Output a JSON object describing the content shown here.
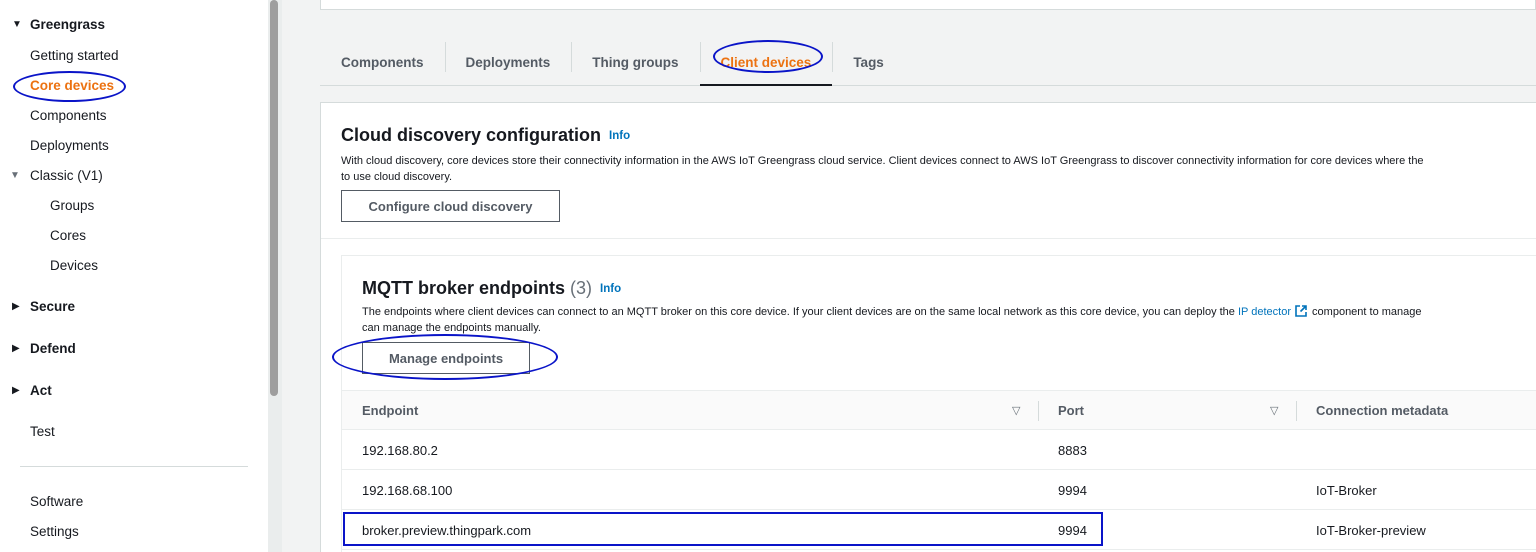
{
  "sidebar": {
    "section_title": "Greengrass",
    "items": [
      {
        "label": "Getting started"
      },
      {
        "label": "Core devices"
      },
      {
        "label": "Components"
      },
      {
        "label": "Deployments"
      },
      {
        "label": "Classic (V1)"
      },
      {
        "label": "Groups"
      },
      {
        "label": "Cores"
      },
      {
        "label": "Devices"
      }
    ],
    "sections": [
      {
        "label": "Secure"
      },
      {
        "label": "Defend"
      },
      {
        "label": "Act"
      }
    ],
    "test_label": "Test",
    "software_label": "Software",
    "settings_label": "Settings"
  },
  "tabs": [
    {
      "label": "Components"
    },
    {
      "label": "Deployments"
    },
    {
      "label": "Thing groups"
    },
    {
      "label": "Client devices"
    },
    {
      "label": "Tags"
    }
  ],
  "cloud_discovery": {
    "title": "Cloud discovery configuration",
    "info": "Info",
    "description_line1": "With cloud discovery, core devices store their connectivity information in the AWS IoT Greengrass cloud service. Client devices connect to AWS IoT Greengrass to discover connectivity information for core devices where the",
    "description_line2": "to use cloud discovery.",
    "button": "Configure cloud discovery"
  },
  "mqtt": {
    "title": "MQTT broker endpoints",
    "count": "(3)",
    "info": "Info",
    "description_pre": "The endpoints where client devices can connect to an MQTT broker on this core device. If your client devices are on the same local network as this core device, you can deploy the",
    "link": "IP detector",
    "description_post": "component to manage",
    "description_line2": "can manage the endpoints manually.",
    "button": "Manage endpoints",
    "columns": [
      "Endpoint",
      "Port",
      "Connection metadata"
    ],
    "rows": [
      {
        "endpoint": "192.168.80.2",
        "port": "8883",
        "metadata": ""
      },
      {
        "endpoint": "192.168.68.100",
        "port": "9994",
        "metadata": "IoT-Broker"
      },
      {
        "endpoint": "broker.preview.thingpark.com",
        "port": "9994",
        "metadata": "IoT-Broker-preview"
      }
    ]
  },
  "colors": {
    "accent": "#ec7211",
    "link": "#0073bb",
    "annotation": "#0a14c8"
  }
}
